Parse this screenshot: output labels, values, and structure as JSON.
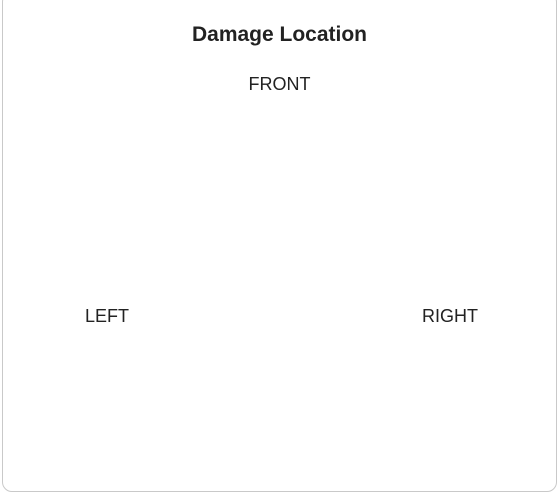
{
  "title": "Damage Location",
  "labels": {
    "front": "FRONT",
    "left": "LEFT",
    "right": "RIGHT"
  }
}
